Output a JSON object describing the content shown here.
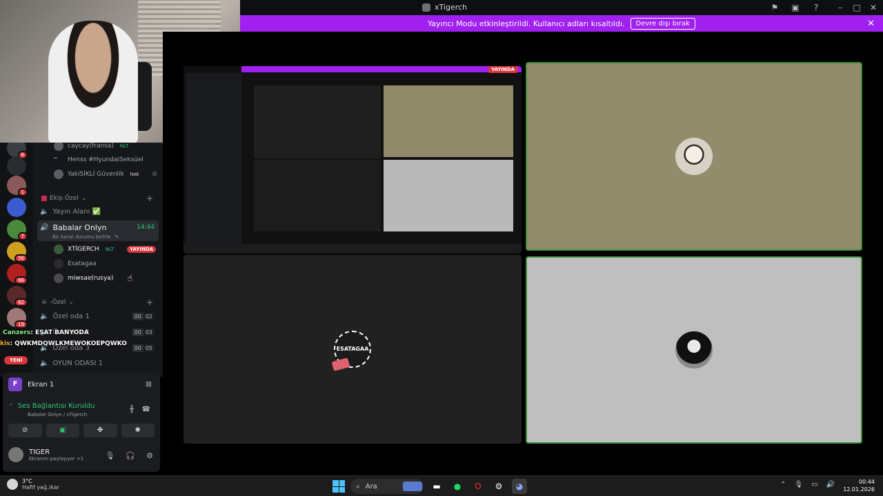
{
  "window": {
    "title": "xTigerch"
  },
  "banner": {
    "message": "Yayıncı Modu etkinleştirildi. Kullanıcı adları kısaltıldı.",
    "button": "Devre dışı bırak"
  },
  "rail": {
    "badges": [
      "6",
      "1",
      "7",
      "56",
      "66",
      "82",
      "19"
    ]
  },
  "channels": {
    "top_users": [
      {
        "name": "caycay(fransa)",
        "tag": "NLT"
      },
      {
        "name": "Henss #HyundaiSeksüel",
        "tag": ""
      },
      {
        "name": "YakiSİKLİ Güvenlik",
        "tag": "lost"
      }
    ],
    "category1": "Ekip Özel",
    "yayin_alani": "Yayın Alanı ✅",
    "selected_channel": "Babalar Onlyn",
    "selected_time": "14:44",
    "selected_status": "Bir kanal durumu belirle",
    "voice_users": [
      {
        "name": "XTİGERCH",
        "tag": "NLT",
        "live": "YAYINDA"
      },
      {
        "name": "Esatagaa",
        "tag": "",
        "live": ""
      },
      {
        "name": "miwsae(rusya)",
        "tag": "",
        "live": ""
      }
    ],
    "category2": "-Özel",
    "rooms": [
      {
        "name": "Özel oda 1",
        "a": "00",
        "b": "02"
      },
      {
        "name": "Özel oda 2",
        "a": "00",
        "b": "03"
      },
      {
        "name": "Özel oda 3",
        "a": "00",
        "b": "05"
      },
      {
        "name": "OYUN ODASI 1",
        "a": "",
        "b": ""
      }
    ]
  },
  "overlay_chat": [
    {
      "user": "Canzers",
      "text": ": ESAT BANYODA"
    },
    {
      "user": "kis",
      "text": ": QWKMDQWLKMEWOKOEPQWKO"
    }
  ],
  "new_badge": "YENİ",
  "userpanel": {
    "screen_label": "Ekran 1",
    "screen_icon": "F",
    "voice_connected": "Ses Bağlantısı Kuruldu",
    "voice_location": "Babalar Onlyn / xTigerch",
    "username": "TIGER",
    "user_status": "Ekranını paylaşıyor +1"
  },
  "stage": {
    "esata_label": "ESATAGAA",
    "share_live": "YAYINDA"
  },
  "taskbar": {
    "temp": "3°C",
    "weather": "Hafif yağ./kar",
    "search_placeholder": "Ara",
    "time": "00:44",
    "date": "12.01.2026"
  }
}
